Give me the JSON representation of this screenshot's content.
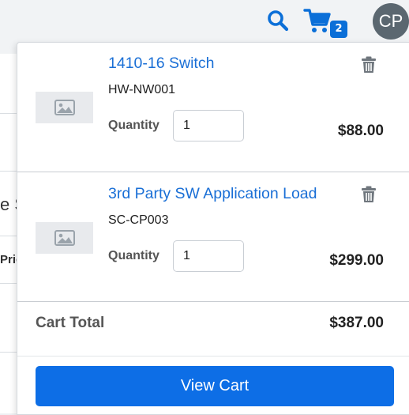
{
  "header": {
    "search_icon": "search-icon",
    "cart_icon": "shopping-cart-icon",
    "cart_count": "2",
    "avatar_initials": "CP",
    "accent_color": "#0b6fd8"
  },
  "background": {
    "fragment_1": "e S",
    "fragment_2": "Pric"
  },
  "cart": {
    "items": [
      {
        "title": "1410-16 Switch",
        "sku": "HW-NW001",
        "quantity_label": "Quantity",
        "quantity": "1",
        "price": "$88.00"
      },
      {
        "title": "3rd Party SW Application Load",
        "sku": "SC-CP003",
        "quantity_label": "Quantity",
        "quantity": "1",
        "price": "$299.00"
      }
    ],
    "total_label": "Cart Total",
    "total_value": "$387.00",
    "view_cart_label": "View Cart"
  }
}
